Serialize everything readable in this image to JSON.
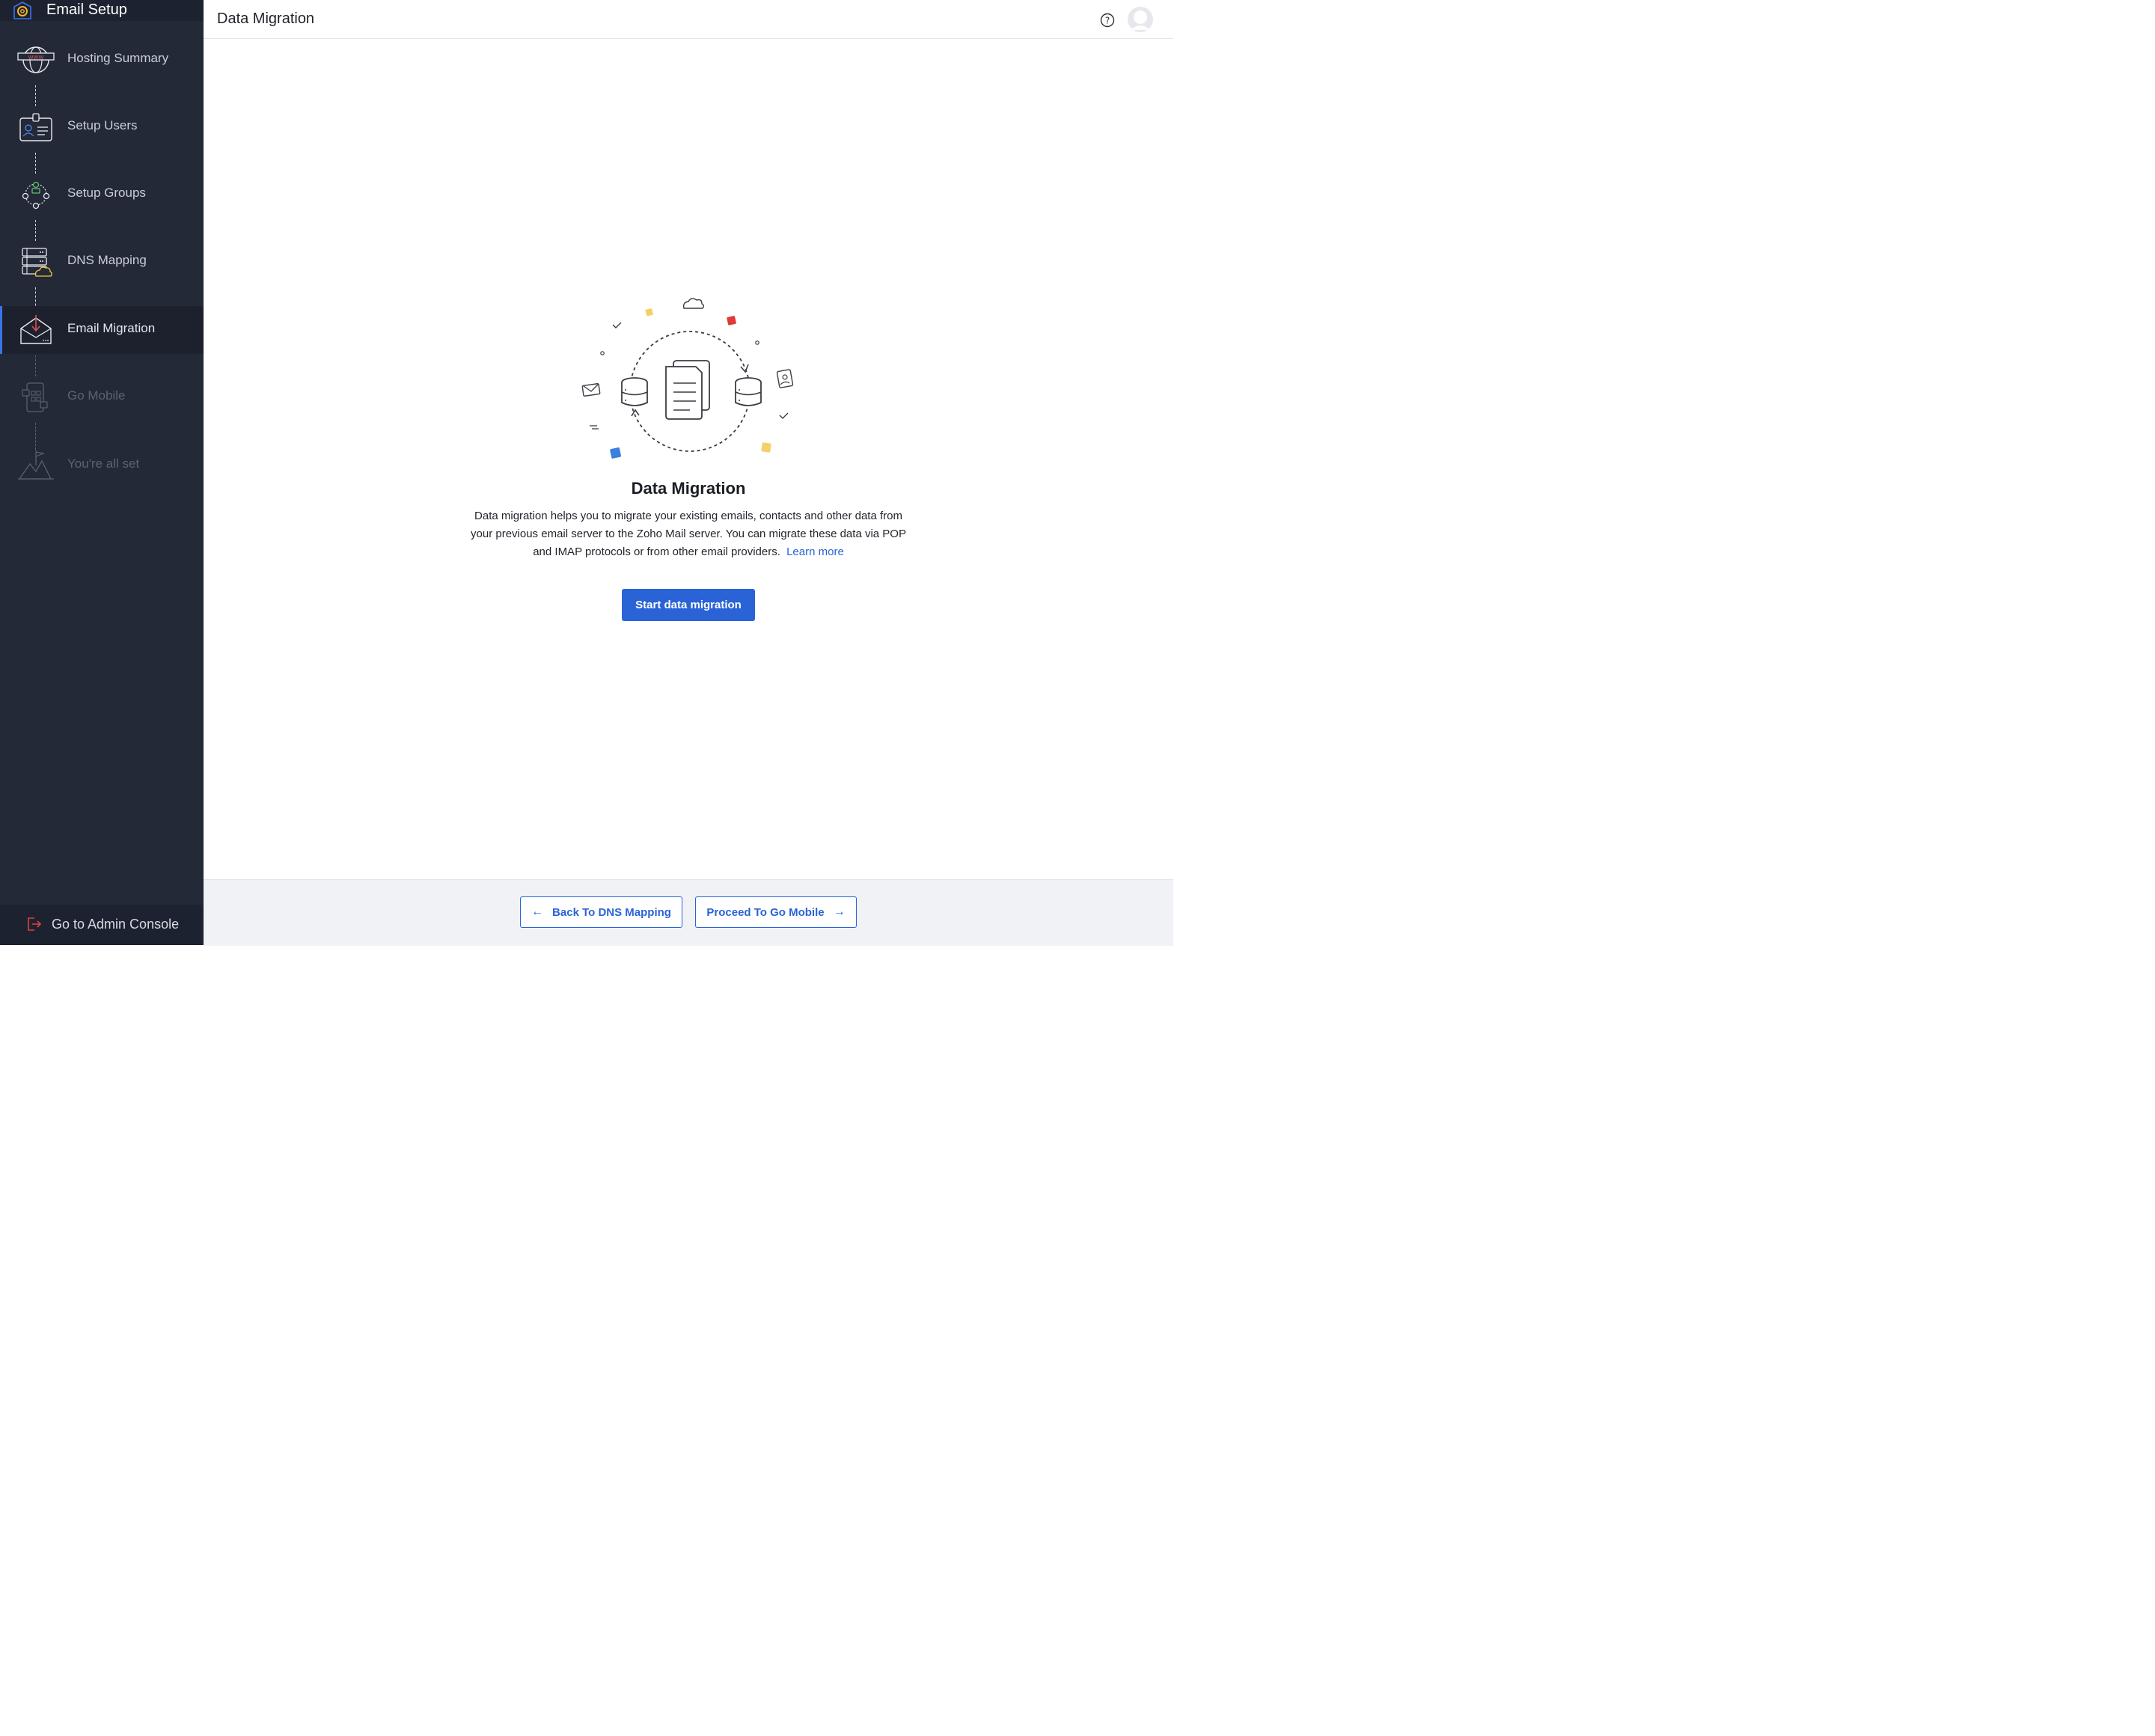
{
  "sidebar": {
    "title": "Email Setup",
    "steps": [
      {
        "label": "Hosting Summary",
        "icon": "globe-www-icon",
        "state": "done"
      },
      {
        "label": "Setup Users",
        "icon": "id-card-icon",
        "state": "done"
      },
      {
        "label": "Setup Groups",
        "icon": "group-network-icon",
        "state": "done"
      },
      {
        "label": "DNS Mapping",
        "icon": "server-cloud-icon",
        "state": "done"
      },
      {
        "label": "Email Migration",
        "icon": "envelope-download-icon",
        "state": "active"
      },
      {
        "label": "Go Mobile",
        "icon": "mobile-apps-icon",
        "state": "disabled"
      },
      {
        "label": "You're all set",
        "icon": "mountain-flag-icon",
        "state": "disabled"
      }
    ],
    "admin_label": "Go to Admin Console"
  },
  "header": {
    "title": "Data Migration"
  },
  "main": {
    "title": "Data Migration",
    "description": "Data migration helps you to migrate your existing emails, contacts and other data from your previous email server to the Zoho Mail server. You can migrate these data via POP and IMAP protocols or from other email providers.",
    "learn_more": "Learn more",
    "start_button": "Start data migration"
  },
  "footer": {
    "back_label": "Back To DNS Mapping",
    "next_label": "Proceed To Go Mobile"
  },
  "colors": {
    "sidebar_bg": "#232937",
    "accent": "#2a63d6",
    "active_indicator": "#3b74e8"
  }
}
